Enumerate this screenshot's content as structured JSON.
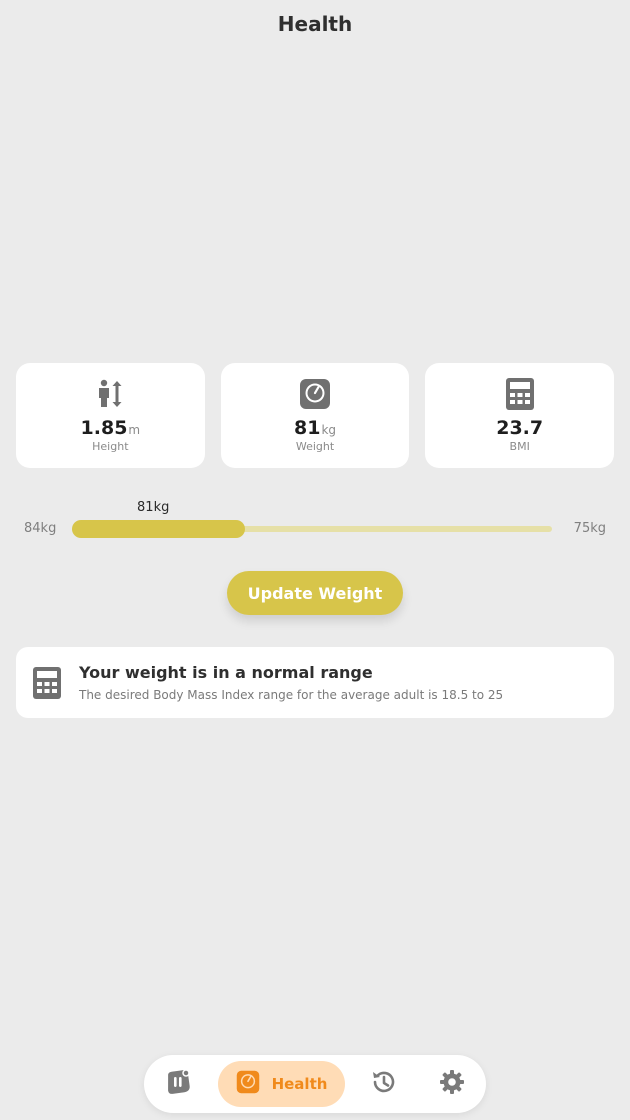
{
  "header": {
    "title": "Health"
  },
  "stats": {
    "height": {
      "value": "1.85",
      "unit": "m",
      "label": "Height",
      "icon": "person-height-icon"
    },
    "weight": {
      "value": "81",
      "unit": "kg",
      "label": "Weight",
      "icon": "scale-icon"
    },
    "bmi": {
      "value": "23.7",
      "label": "BMI",
      "icon": "calculator-icon"
    }
  },
  "weight_range": {
    "start_label": "84kg",
    "end_label": "75kg",
    "current_label": "81kg",
    "start": 84,
    "end": 75,
    "current": 81,
    "progress": 0.36
  },
  "update_button": {
    "label": "Update Weight"
  },
  "info": {
    "title": "Your weight is in a normal range",
    "description": "The desired Body Mass Index range for the average adult is 18.5 to 25",
    "icon": "calculator-icon"
  },
  "nav": {
    "items": [
      {
        "icon": "journal-icon",
        "label": ""
      },
      {
        "icon": "scale-icon",
        "label": "Health",
        "active": true
      },
      {
        "icon": "history-icon",
        "label": ""
      },
      {
        "icon": "gear-icon",
        "label": ""
      }
    ]
  },
  "colors": {
    "accent": "#d7c54a",
    "track": "#e6e0a7",
    "nav_active_bg": "#ffdcb6",
    "nav_active_fg": "#f08a1c",
    "icon": "#707070",
    "background": "#ebebeb"
  }
}
